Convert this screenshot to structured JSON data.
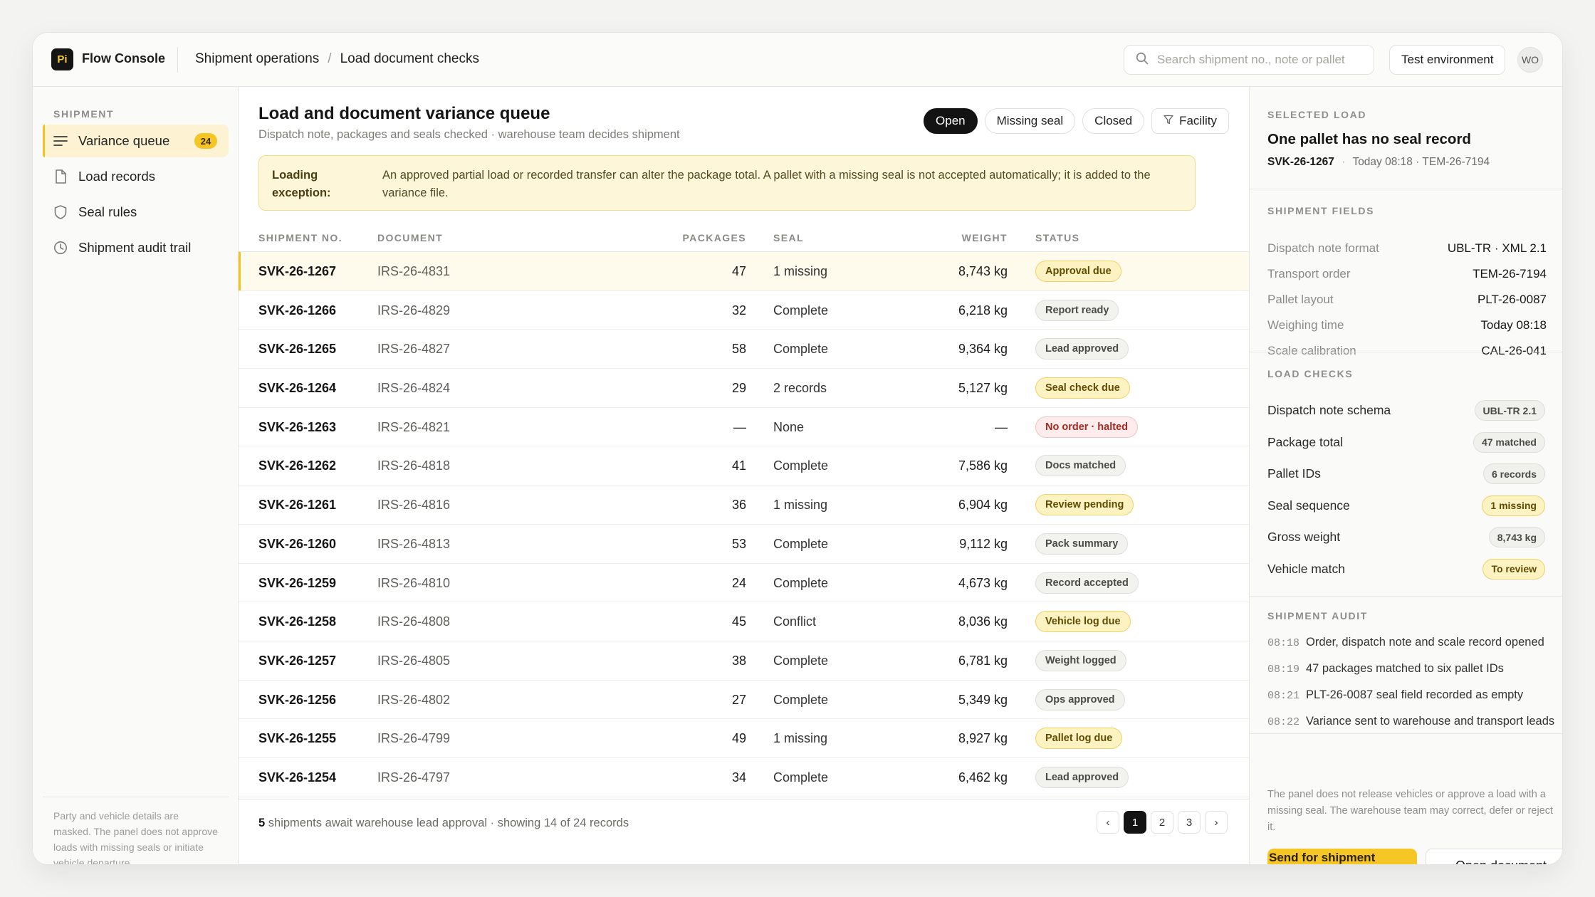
{
  "app": {
    "logo": "Pi",
    "name": "Flow Console"
  },
  "breadcrumb": [
    "Shipment operations",
    "Load document checks"
  ],
  "search": {
    "placeholder": "Search shipment no., note or pallet"
  },
  "env_button": "Test environment",
  "avatar": "WO",
  "sidebar": {
    "heading": "SHIPMENT",
    "items": [
      {
        "label": "Variance queue",
        "icon": "list-icon",
        "badge": "24",
        "active": true
      },
      {
        "label": "Load records",
        "icon": "document-icon"
      },
      {
        "label": "Seal rules",
        "icon": "shield-icon"
      },
      {
        "label": "Shipment audit trail",
        "icon": "clock-icon"
      }
    ],
    "note": "Party and vehicle details are masked. The panel does not approve loads with missing seals or initiate vehicle departure."
  },
  "main": {
    "title": "Load and document variance queue",
    "subtitle": "Dispatch note, packages and seals checked · warehouse team decides shipment",
    "filters": [
      "Open",
      "Missing seal",
      "Closed",
      "Facility"
    ],
    "banner": {
      "label": "Loading exception:",
      "text": "An approved partial load or recorded transfer can alter the package total. A pallet with a missing seal is not accepted automatically; it is added to the variance file."
    },
    "columns": [
      "SHIPMENT NO.",
      "DOCUMENT",
      "PACKAGES",
      "SEAL",
      "WEIGHT",
      "STATUS"
    ],
    "rows": [
      {
        "ship": "SVK-26-1267",
        "doc": "IRS-26-4831",
        "packages": "47",
        "seal": "1 missing",
        "weight": "8,743 kg",
        "status": "Approval due",
        "tone": "warn",
        "selected": true
      },
      {
        "ship": "SVK-26-1266",
        "doc": "IRS-26-4829",
        "packages": "32",
        "seal": "Complete",
        "weight": "6,218 kg",
        "status": "Report ready",
        "tone": "neutral"
      },
      {
        "ship": "SVK-26-1265",
        "doc": "IRS-26-4827",
        "packages": "58",
        "seal": "Complete",
        "weight": "9,364 kg",
        "status": "Lead approved",
        "tone": "neutral"
      },
      {
        "ship": "SVK-26-1264",
        "doc": "IRS-26-4824",
        "packages": "29",
        "seal": "2 records",
        "weight": "5,127 kg",
        "status": "Seal check due",
        "tone": "warn"
      },
      {
        "ship": "SVK-26-1263",
        "doc": "IRS-26-4821",
        "packages": "—",
        "seal": "None",
        "weight": "—",
        "status": "No order · halted",
        "tone": "danger"
      },
      {
        "ship": "SVK-26-1262",
        "doc": "IRS-26-4818",
        "packages": "41",
        "seal": "Complete",
        "weight": "7,586 kg",
        "status": "Docs matched",
        "tone": "neutral"
      },
      {
        "ship": "SVK-26-1261",
        "doc": "IRS-26-4816",
        "packages": "36",
        "seal": "1 missing",
        "weight": "6,904 kg",
        "status": "Review pending",
        "tone": "warn"
      },
      {
        "ship": "SVK-26-1260",
        "doc": "IRS-26-4813",
        "packages": "53",
        "seal": "Complete",
        "weight": "9,112 kg",
        "status": "Pack summary",
        "tone": "neutral"
      },
      {
        "ship": "SVK-26-1259",
        "doc": "IRS-26-4810",
        "packages": "24",
        "seal": "Complete",
        "weight": "4,673 kg",
        "status": "Record accepted",
        "tone": "neutral"
      },
      {
        "ship": "SVK-26-1258",
        "doc": "IRS-26-4808",
        "packages": "45",
        "seal": "Conflict",
        "weight": "8,036 kg",
        "status": "Vehicle log due",
        "tone": "warn"
      },
      {
        "ship": "SVK-26-1257",
        "doc": "IRS-26-4805",
        "packages": "38",
        "seal": "Complete",
        "weight": "6,781 kg",
        "status": "Weight logged",
        "tone": "neutral"
      },
      {
        "ship": "SVK-26-1256",
        "doc": "IRS-26-4802",
        "packages": "27",
        "seal": "Complete",
        "weight": "5,349 kg",
        "status": "Ops approved",
        "tone": "neutral"
      },
      {
        "ship": "SVK-26-1255",
        "doc": "IRS-26-4799",
        "packages": "49",
        "seal": "1 missing",
        "weight": "8,927 kg",
        "status": "Pallet log due",
        "tone": "warn"
      },
      {
        "ship": "SVK-26-1254",
        "doc": "IRS-26-4797",
        "packages": "34",
        "seal": "Complete",
        "weight": "6,462 kg",
        "status": "Lead approved",
        "tone": "neutral"
      }
    ],
    "footer": {
      "count": "5",
      "text": "shipments await warehouse lead approval · showing 14 of 24 records"
    },
    "pager": {
      "prev": "‹",
      "pages": [
        "1",
        "2",
        "3"
      ],
      "current": "1",
      "next": "›"
    }
  },
  "panel": {
    "selected_heading": "SELECTED LOAD",
    "selected_title": "One pallet has no seal record",
    "selected_id": "SVK-26-1267",
    "selected_meta": "Today 08:18 · TEM-26-7194",
    "fields_heading": "SHIPMENT FIELDS",
    "fields": [
      {
        "k": "Dispatch note format",
        "v": "UBL-TR · XML 2.1"
      },
      {
        "k": "Transport order",
        "v": "TEM-26-7194"
      },
      {
        "k": "Pallet layout",
        "v": "PLT-26-0087"
      },
      {
        "k": "Weighing time",
        "v": "Today 08:18"
      },
      {
        "k": "Scale calibration",
        "v": "CAL-26-041"
      }
    ],
    "checks_heading": "LOAD CHECKS",
    "checks": [
      {
        "k": "Dispatch note schema",
        "v": "UBL-TR 2.1",
        "tone": "neutral"
      },
      {
        "k": "Package total",
        "v": "47 matched",
        "tone": "neutral"
      },
      {
        "k": "Pallet IDs",
        "v": "6 records",
        "tone": "neutral"
      },
      {
        "k": "Seal sequence",
        "v": "1 missing",
        "tone": "warn"
      },
      {
        "k": "Gross weight",
        "v": "8,743 kg",
        "tone": "neutral"
      },
      {
        "k": "Vehicle match",
        "v": "To review",
        "tone": "warn"
      }
    ],
    "audit_heading": "SHIPMENT AUDIT",
    "audit": [
      {
        "t": "08:18",
        "text": "Order, dispatch note and scale record opened"
      },
      {
        "t": "08:19",
        "text": "47 packages matched to six pallet IDs"
      },
      {
        "t": "08:21",
        "text": "PLT-26-0087 seal field recorded as empty"
      },
      {
        "t": "08:22",
        "text": "Variance sent to warehouse and transport leads"
      }
    ],
    "note": "The panel does not release vehicles or approve a load with a missing seal. The warehouse team may correct, defer or reject it.",
    "primary_button": "Send for shipment approval",
    "secondary_button": "Open document"
  },
  "colors": {
    "accent": "#f6c626",
    "dark": "#131313",
    "warn_bg": "#fdf2c2",
    "danger_text": "#a12a23"
  }
}
